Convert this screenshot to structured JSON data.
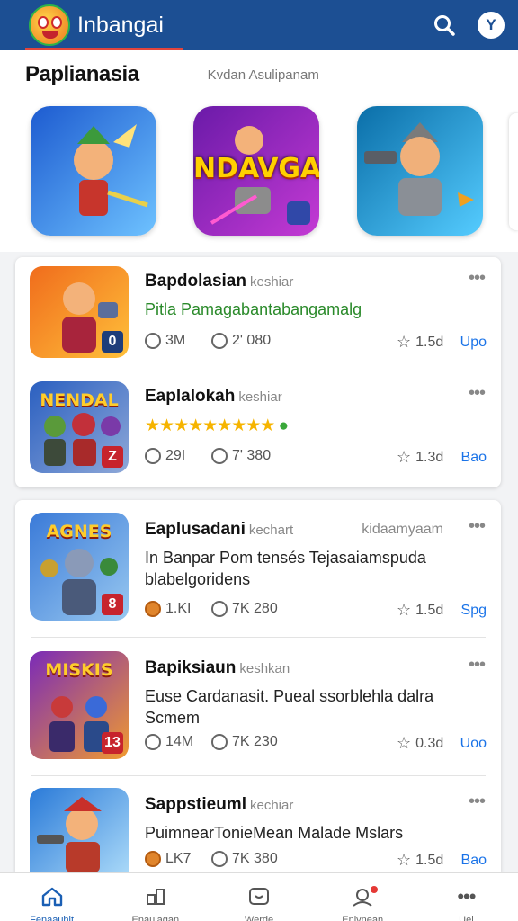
{
  "app": {
    "title": "Inbangai"
  },
  "section": {
    "title": "Paplianasia",
    "subtitle": "Kvdan Asulipanam"
  },
  "featured": [
    {
      "label": "",
      "colors": [
        "#2a6ad6",
        "#8fd0ff"
      ]
    },
    {
      "label": "NDAVGA",
      "colors": [
        "#7a1fb0",
        "#c83ad8"
      ]
    },
    {
      "label": "",
      "colors": [
        "#0c77b8",
        "#5ad0ff"
      ]
    }
  ],
  "cards": [
    {
      "items": [
        {
          "title": "Bapdolasian",
          "tag": "keshiar",
          "right": "",
          "desc": "Pitla Pamagabantabangamalg",
          "desc_style": "green",
          "stars": "",
          "thumb_label": "",
          "badge": "0",
          "stat1": "3M",
          "stat2": "2' 080",
          "stat3": "1.5d",
          "action": "Upo"
        },
        {
          "title": "Eaplalokah",
          "tag": "keshiar",
          "right": "",
          "desc": "",
          "desc_style": "",
          "stars": "★★★★★★★★★",
          "thumb_label": "NENDAL",
          "badge": "Z",
          "stat1": "29I",
          "stat2": "7' 380",
          "stat3": "1.3d",
          "action": "Bao"
        }
      ]
    },
    {
      "items": [
        {
          "title": "Eaplusadani",
          "tag": "kechart",
          "right": "kidaamyaam",
          "desc": "In Banpar Pom tensés Tejasaiamspuda blabelgoridens",
          "desc_style": "",
          "stars": "",
          "thumb_label": "AGNES",
          "badge": "8",
          "stat1": "1.KI",
          "stat2": "7K 280",
          "stat3": "1.5d",
          "action": "Spg"
        },
        {
          "title": "Bapiksiaun",
          "tag": "keshkan",
          "right": "",
          "desc": "Euse Cardanasit. Pueal ssorblehla dalra Scmem",
          "desc_style": "",
          "stars": "",
          "thumb_label": "MISKIS",
          "badge": "13",
          "stat1": "14M",
          "stat2": "7K 230",
          "stat3": "0.3d",
          "action": "Uoo"
        },
        {
          "title": "Sappstieuml",
          "tag": "kechiar",
          "right": "",
          "desc": "PuimnearTonieMean Malade Mslars",
          "desc_style": "",
          "stars": "",
          "thumb_label": "",
          "badge": "",
          "stat1": "LK7",
          "stat2": "7K 380",
          "stat3": "1.5d",
          "action": "Bao"
        }
      ]
    }
  ],
  "nav": [
    {
      "label": "Fenaauhit",
      "icon": "home-icon"
    },
    {
      "label": "Enaulagan",
      "icon": "apps-icon"
    },
    {
      "label": "Werde",
      "icon": "chat-icon"
    },
    {
      "label": "Enivnean",
      "icon": "account-icon"
    },
    {
      "label": "Uel",
      "icon": "more-icon"
    }
  ],
  "colors": {
    "brand": "#1c4f93",
    "accent": "#e2453c",
    "link": "#1a73e8"
  }
}
